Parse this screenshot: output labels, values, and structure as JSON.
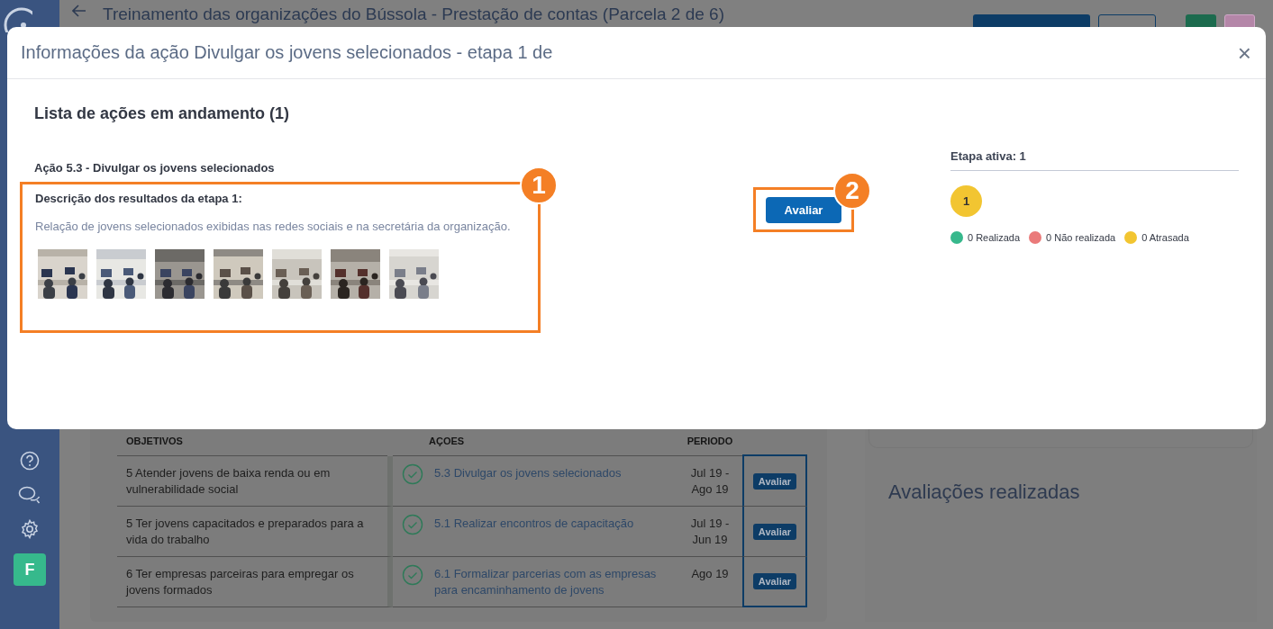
{
  "sidebar": {
    "avatar": "F"
  },
  "header": {
    "title": "Treinamento das organizações do Bússola - Prestação de contas (Parcela 2 de 6)"
  },
  "table": {
    "columns": [
      "OBJETIVOS",
      "AÇOES",
      "PERIODO"
    ],
    "rows": [
      {
        "objective": "5 Atender jovens de baixa renda ou em vulnerabilidade social",
        "action": "5.3 Divulgar os jovens selecionados",
        "period": "Jul 19 - Ago 19",
        "button": "Avaliar"
      },
      {
        "objective": "5 Ter jovens capacitados e preparados para a vida do trabalho",
        "action": "5.1 Realizar encontros de capacitação",
        "period": "Jul 19 - Jun 19",
        "button": "Avaliar"
      },
      {
        "objective": "6 Ter empresas parceiras para empregar os jovens formados",
        "action": "6.1 Formalizar parcerias com as empresas para encaminhamento de jovens",
        "period": "Ago 19",
        "button": "Avaliar"
      }
    ]
  },
  "evaluations_panel": {
    "title": "Avaliações realizadas"
  },
  "modal": {
    "title": "Informações da ação Divulgar os jovens selecionados - etapa 1 de",
    "close": "×",
    "heading": "Lista de ações em andamento (1)",
    "action_title": "Ação 5.3 - Divulgar os jovens selecionados",
    "step_description_label": "Descrição dos resultados da etapa 1:",
    "step_description": "Relação de jovens selecionados exibidas nas redes sociais e na secretária da organização.",
    "evaluate_button": "Avaliar",
    "active_step": "Etapa ativa: 1",
    "step_badge": "1",
    "legend": [
      {
        "label": "0 Realizada",
        "color": "#37b88c"
      },
      {
        "label": "0 Não realizada",
        "color": "#ea7a7a"
      },
      {
        "label": "0 Atrasada",
        "color": "#f2c531"
      }
    ]
  },
  "callouts": [
    {
      "label": "1"
    },
    {
      "label": "2"
    }
  ]
}
